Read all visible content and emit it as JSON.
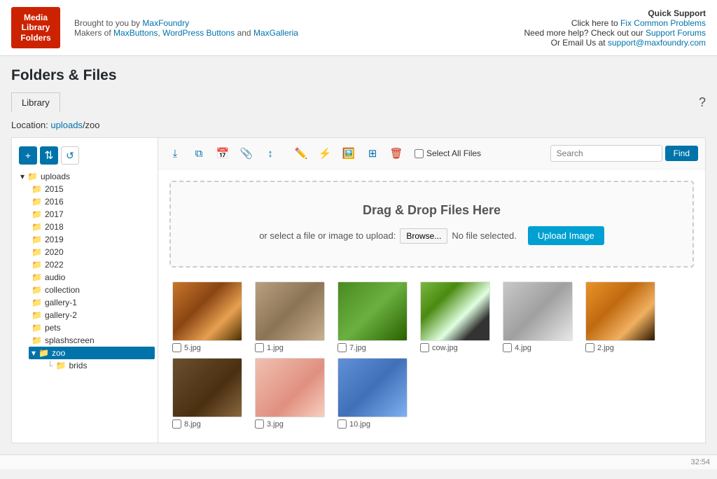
{
  "logo": {
    "line1": "Media",
    "line2": "Library",
    "line3": "Folders"
  },
  "header": {
    "brought_by": "Brought to you by",
    "maker_name": "MaxFoundry",
    "makers_of": "Makers of",
    "maxbuttons": "MaxButtons",
    "wordpress_buttons": "WordPress Buttons",
    "and": "and",
    "maxgalleria": "MaxGalleria"
  },
  "quick_support": {
    "title": "Quick Support",
    "fix_line": "Click here to",
    "fix_link": "Fix Common Problems",
    "need_more": "Need more help? Check out our",
    "support_forums": "Support Forums",
    "email_line": "Or Email Us at",
    "email": "support@maxfoundry.com"
  },
  "page": {
    "title": "Folders & Files"
  },
  "tabs": [
    {
      "label": "Library",
      "active": true
    }
  ],
  "location": {
    "prefix": "Location:",
    "path_link": "uploads",
    "path_rest": "/zoo"
  },
  "sidebar": {
    "add_tooltip": "+",
    "move_tooltip": "↕",
    "refresh_tooltip": "↺",
    "tree": {
      "root_label": "uploads",
      "children": [
        {
          "label": "2015"
        },
        {
          "label": "2016"
        },
        {
          "label": "2017"
        },
        {
          "label": "2018"
        },
        {
          "label": "2019"
        },
        {
          "label": "2020"
        },
        {
          "label": "2022"
        },
        {
          "label": "audio"
        },
        {
          "label": "collection"
        },
        {
          "label": "gallery-1"
        },
        {
          "label": "gallery-2"
        },
        {
          "label": "pets"
        },
        {
          "label": "splashscreen"
        },
        {
          "label": "zoo",
          "selected": true,
          "children": [
            {
              "label": "brids"
            }
          ]
        }
      ]
    }
  },
  "toolbar": {
    "icons": [
      "⤓",
      "⧉",
      "📅",
      "📋",
      "↕",
      "✏️",
      "⚡",
      "🖼️",
      "⊡",
      "🗑"
    ],
    "select_all_label": "Select All Files",
    "search_placeholder": "Search",
    "find_label": "Find"
  },
  "dropzone": {
    "title": "Drag & Drop Files Here",
    "or_text": "or select a file or image to upload:",
    "browse_label": "Browse...",
    "no_file": "No file selected.",
    "upload_label": "Upload Image"
  },
  "files": [
    {
      "name": "5.jpg",
      "color_class": "animal-tiger"
    },
    {
      "name": "1.jpg",
      "color_class": "animal-kangaroo"
    },
    {
      "name": "7.jpg",
      "color_class": "animal-parrots"
    },
    {
      "name": "cow.jpg",
      "color_class": "animal-cow"
    },
    {
      "name": "4.jpg",
      "color_class": "animal-snow-leopard"
    },
    {
      "name": "2.jpg",
      "color_class": "animal-tiger2"
    },
    {
      "name": "8.jpg",
      "color_class": "animal-bear"
    },
    {
      "name": "3.jpg",
      "color_class": "animal-pig"
    },
    {
      "name": "10.jpg",
      "color_class": "animal-parrot2"
    }
  ],
  "status": {
    "time": "32:54"
  }
}
